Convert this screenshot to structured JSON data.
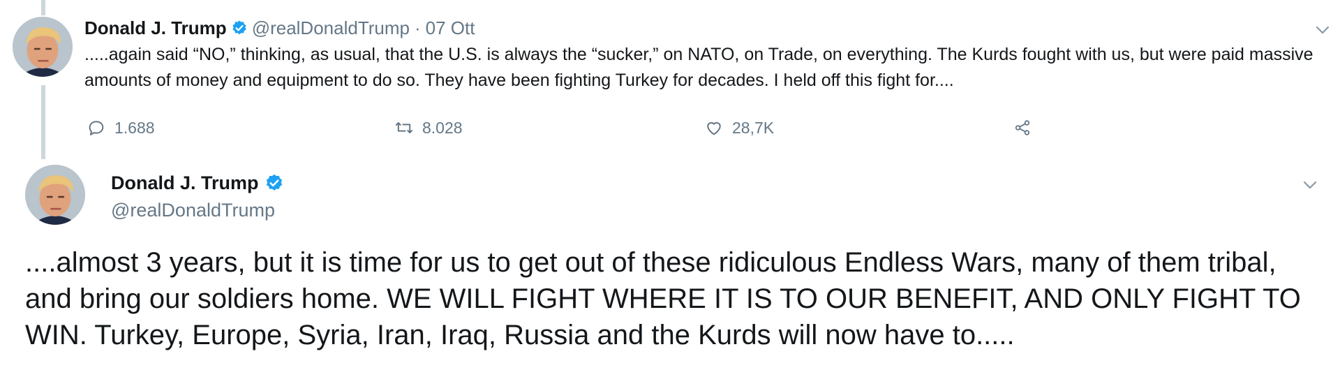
{
  "tweet1": {
    "name": "Donald J. Trump",
    "handle": "@realDonaldTrump",
    "separator": "·",
    "date": "07 Ott",
    "text": ".....again said “NO,” thinking, as usual, that the U.S. is always the “sucker,” on NATO, on Trade, on everything. The Kurds fought with us, but were paid massive amounts of money and equipment to do so. They have been fighting Turkey for decades. I held off this fight for....",
    "actions": {
      "replies": "1.688",
      "retweets": "8.028",
      "likes": "28,7K"
    }
  },
  "tweet2": {
    "name": "Donald J. Trump",
    "handle": "@realDonaldTrump",
    "text": "....almost 3 years, but it is time for us to get out of these ridiculous Endless Wars, many of them tribal, and bring our soldiers home. WE WILL FIGHT WHERE IT IS TO OUR BENEFIT, AND ONLY FIGHT TO WIN. Turkey, Europe, Syria, Iran, Iraq, Russia and the Kurds will now have to....."
  },
  "colors": {
    "verified": "#1da1f2",
    "muted": "#657786",
    "thread_line": "#ccd6dd",
    "text": "#14171a"
  },
  "icons": {
    "reply": "speech-bubble",
    "retweet": "retweet-arrows",
    "like": "heart-outline",
    "share": "share-nodes",
    "more": "chevron-down",
    "verified": "verified-badge"
  }
}
